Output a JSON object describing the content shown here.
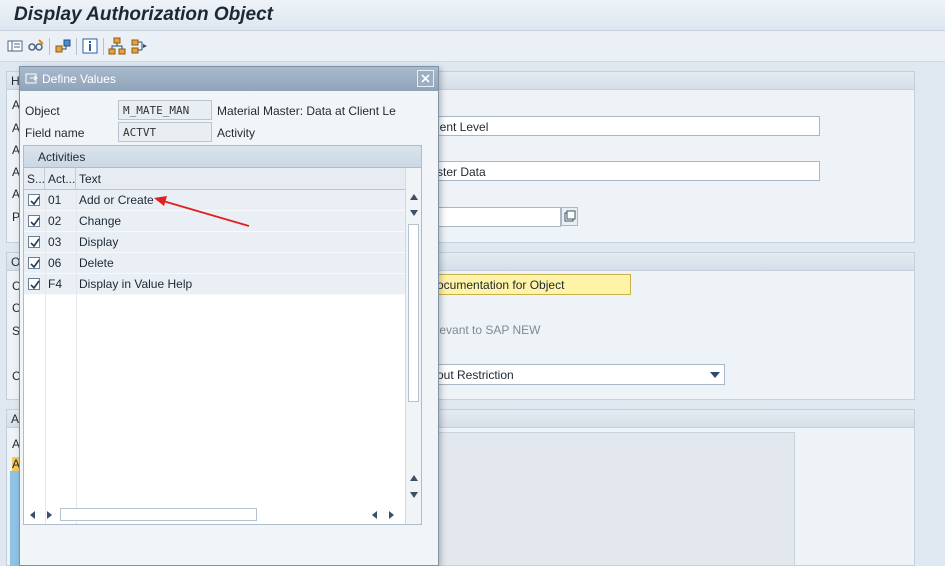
{
  "window": {
    "title": "Display Authorization Object"
  },
  "background": {
    "panel1_title_char": "H",
    "panel1_labels": [
      "A",
      "A",
      "A",
      "A",
      "A",
      "P"
    ],
    "field_client_level": "ient Level",
    "field_master_data": "ster Data",
    "panel2_title_char": "O",
    "panel2_labels": [
      "C",
      "C",
      "S",
      "C"
    ],
    "doc_button": "ocumentation for Object",
    "sap_new_text": "elevant to SAP NEW",
    "dropdown_value": "out Restriction",
    "panel3_title_char": "A",
    "panel3_labels": [
      "A",
      "A"
    ]
  },
  "dialog": {
    "title": "Define Values",
    "object_label": "Object",
    "object_value": "M_MATE_MAN",
    "object_desc": "Material Master: Data at Client Le",
    "field_label": "Field name",
    "field_value": "ACTVT",
    "field_desc": "Activity",
    "table_title": "Activities",
    "columns": [
      "S...",
      "Act...",
      "Text"
    ],
    "rows": [
      {
        "act": "01",
        "text": "Add or Create",
        "checked": true
      },
      {
        "act": "02",
        "text": "Change",
        "checked": true
      },
      {
        "act": "03",
        "text": "Display",
        "checked": true
      },
      {
        "act": "06",
        "text": "Delete",
        "checked": true
      },
      {
        "act": "F4",
        "text": "Display in Value Help",
        "checked": true
      }
    ]
  },
  "colors": {
    "annotation_arrow": "#e02020",
    "doc_button_bg": "#fff3a8"
  }
}
